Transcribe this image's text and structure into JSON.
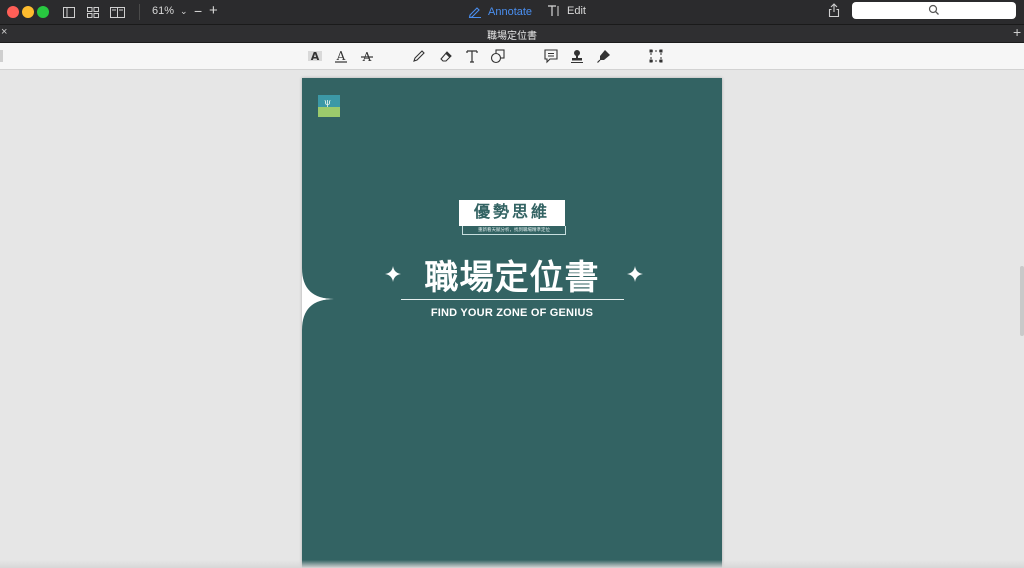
{
  "window": {
    "traffic_lights": [
      "close",
      "minimize",
      "zoom"
    ],
    "zoom_label": "61%",
    "zoom_out_label": "−",
    "zoom_in_label": "+",
    "modes": {
      "annotate_label": "Annotate",
      "edit_label": "Edit"
    },
    "active_mode": "Annotate",
    "search": {
      "placeholder": ""
    }
  },
  "tab": {
    "title": "職場定位書",
    "close_glyph": "×",
    "add_glyph": "+"
  },
  "toolbar": {
    "tools": [
      "highlight-text-icon",
      "underline-text-icon",
      "strikethrough-text-icon",
      "pencil-icon",
      "eraser-icon",
      "text-tool-icon",
      "shapes-icon",
      "comment-icon",
      "stamp-icon",
      "signature-pen-icon",
      "select-area-icon"
    ]
  },
  "document": {
    "label": "優勢思維",
    "subtitle": "重新看天賦分析，找到職場精準定位",
    "title": "職場定位書",
    "tagline": "FIND YOUR ZONE OF GENIUS",
    "logo_mark": "ψ",
    "colors": {
      "page_bg": "#336363",
      "logo_top": "#3c98a6",
      "logo_bottom": "#9cca6c",
      "accent": "#ffffff"
    }
  },
  "colors": {
    "annotate_accent": "#4a8ff0",
    "titlebar": "#2b2b2d"
  }
}
